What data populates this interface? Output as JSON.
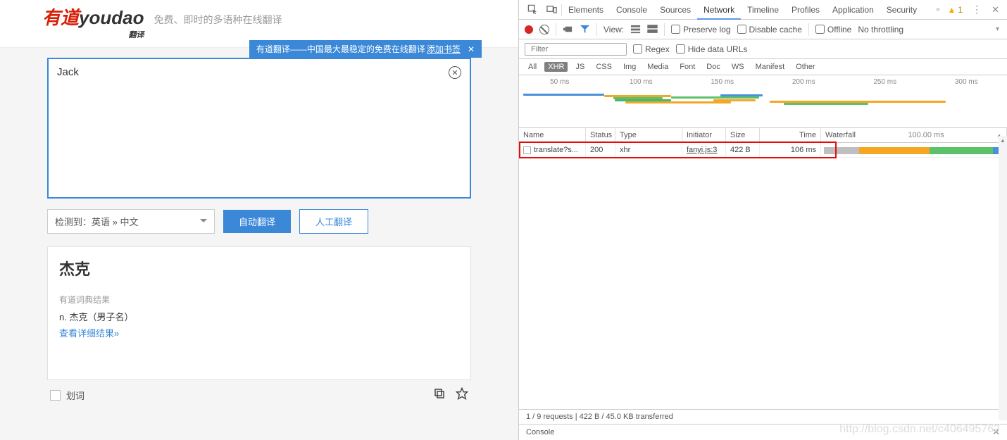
{
  "header": {
    "logo_cn": "有道",
    "logo_en": "youdao",
    "logo_sub": "翻译",
    "tagline": "免费、即时的多语种在线翻译"
  },
  "promo": {
    "prefix": "有道翻译——中国最大最稳定的免费在线翻译 ",
    "link": "添加书签"
  },
  "input": {
    "text": "Jack"
  },
  "controls": {
    "dropdown": "检测到：英语 » 中文",
    "auto": "自动翻译",
    "human": "人工翻译"
  },
  "result": {
    "title": "杰克",
    "sub": "有道词典结果",
    "def": "n. 杰克（男子名）",
    "more": "查看详细结果»"
  },
  "footer": {
    "huaci": "划词"
  },
  "devtools": {
    "tabs": [
      "Elements",
      "Console",
      "Sources",
      "Network",
      "Timeline",
      "Profiles",
      "Application",
      "Security"
    ],
    "active_tab": "Network",
    "warn_count": "1",
    "toolbar": {
      "view": "View:",
      "preserve": "Preserve log",
      "disable": "Disable cache",
      "offline": "Offline",
      "throttle": "No throttling"
    },
    "filterbar": {
      "placeholder": "Filter",
      "regex": "Regex",
      "hide": "Hide data URLs"
    },
    "filter_types": [
      "All",
      "XHR",
      "JS",
      "CSS",
      "Img",
      "Media",
      "Font",
      "Doc",
      "WS",
      "Manifest",
      "Other"
    ],
    "selected_filter": "XHR",
    "timeline_ticks": [
      "50 ms",
      "100 ms",
      "150 ms",
      "200 ms",
      "250 ms",
      "300 ms"
    ],
    "columns": {
      "name": "Name",
      "status": "Status",
      "type": "Type",
      "initiator": "Initiator",
      "size": "Size",
      "time": "Time",
      "waterfall": "Waterfall",
      "wf_total": "100.00 ms"
    },
    "rows": [
      {
        "name": "translate?s...",
        "status": "200",
        "type": "xhr",
        "initiator": "fanyi.js:3",
        "size": "422 B",
        "time": "106 ms"
      }
    ],
    "status": "1 / 9 requests  |  422 B / 45.0 KB transferred",
    "drawer": "Console"
  },
  "watermark": "http://blog.csdn.net/c406495762"
}
